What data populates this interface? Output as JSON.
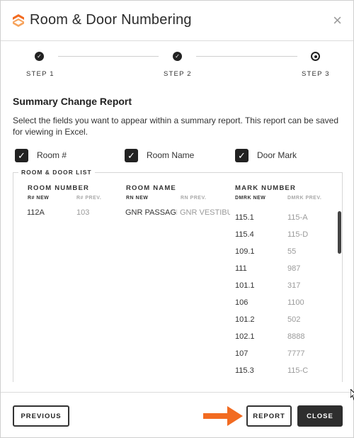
{
  "header": {
    "title": "Room & Door Numbering",
    "close_glyph": "×"
  },
  "stepper": {
    "steps": [
      {
        "label": "STEP 1",
        "state": "done"
      },
      {
        "label": "STEP 2",
        "state": "done"
      },
      {
        "label": "STEP 3",
        "state": "current"
      }
    ],
    "check_glyph": "✓"
  },
  "summary": {
    "title": "Summary Change Report",
    "description": "Select the fields you want to appear within a summary report. This report can be saved for viewing in Excel.",
    "checkboxes": [
      {
        "label": "Room #",
        "checked": true
      },
      {
        "label": "Room Name",
        "checked": true
      },
      {
        "label": "Door Mark",
        "checked": true
      }
    ],
    "check_glyph": "✓"
  },
  "list": {
    "legend": "ROOM & DOOR LIST",
    "columns": [
      {
        "title": "ROOM NUMBER",
        "sub_new": "R# NEW",
        "sub_prev": "R# PREV."
      },
      {
        "title": "ROOM NAME",
        "sub_new": "RN NEW",
        "sub_prev": "RN PREV."
      },
      {
        "title": "MARK NUMBER",
        "sub_new": "DMRK NEW",
        "sub_prev": "DMRK PREV."
      }
    ],
    "room": {
      "new": "112A",
      "prev": "103"
    },
    "room_name": {
      "new": "GNR PASSAGE",
      "prev": "GNR VESTIBULE"
    },
    "marks": [
      {
        "new": "115.1",
        "prev": "115-A"
      },
      {
        "new": "115.4",
        "prev": "115-D"
      },
      {
        "new": "109.1",
        "prev": "55"
      },
      {
        "new": "111",
        "prev": "987"
      },
      {
        "new": "101.1",
        "prev": "317"
      },
      {
        "new": "106",
        "prev": "1100"
      },
      {
        "new": "101.2",
        "prev": "502"
      },
      {
        "new": "102.1",
        "prev": "8888"
      },
      {
        "new": "107",
        "prev": "7777"
      },
      {
        "new": "115.3",
        "prev": "115-C"
      }
    ]
  },
  "footer": {
    "previous_label": "PREVIOUS",
    "report_label": "REPORT",
    "close_label": "CLOSE"
  },
  "colors": {
    "brand_orange": "#f26b21",
    "dark": "#2e2e2e",
    "muted": "#9a9a9a"
  }
}
